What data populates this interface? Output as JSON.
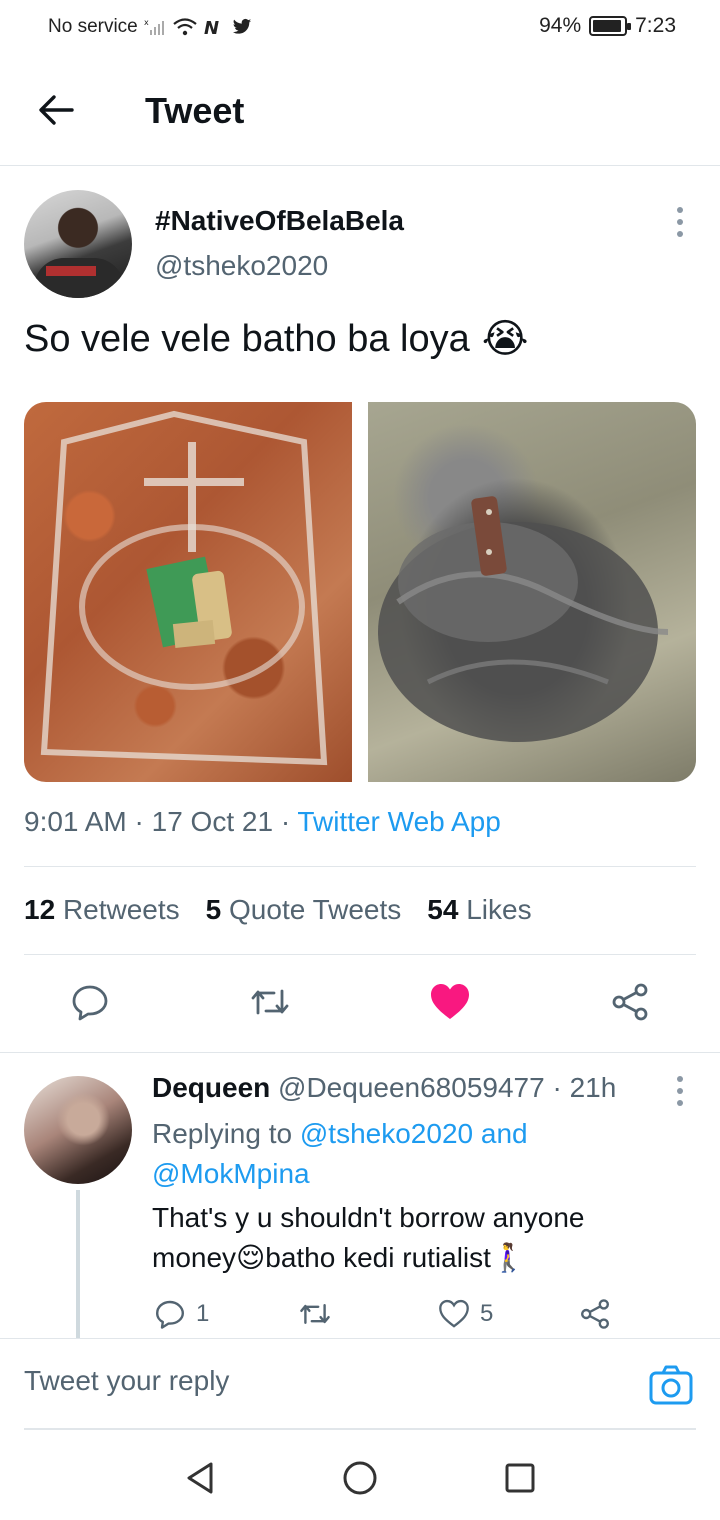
{
  "status_bar": {
    "carrier": "No service",
    "battery": "94%",
    "battery_fraction": 0.94,
    "time": "7:23"
  },
  "header": {
    "title": "Tweet"
  },
  "tweet": {
    "author_name": "#NativeOfBelaBela",
    "author_handle": "@tsheko2020",
    "text": "So vele vele batho ba loya",
    "emoji": "😭",
    "time": "9:01 AM",
    "date": "17 Oct 21",
    "separator": "·",
    "source": "Twitter Web App",
    "retweets_count": "12",
    "retweets_label": "Retweets",
    "quotes_count": "5",
    "quotes_label": "Quote Tweets",
    "likes_count": "54",
    "likes_label": "Likes",
    "liked": true
  },
  "reply": {
    "author_name": "Dequeen",
    "author_handle": "@Dequeen68059477",
    "age": "21h",
    "replying_prefix": "Replying to",
    "replying_to_1": "@tsheko2020",
    "replying_and": "and",
    "replying_to_2": "@MokMpina",
    "text_line1": "That's y u shouldn't borrow anyone",
    "text_line2_a": "money",
    "emoji_1": "😌",
    "text_line2_b": "batho kedi rutialist",
    "emoji_2": "🚶‍♀️",
    "reply_count": "1",
    "like_count": "5"
  },
  "composer": {
    "placeholder": "Tweet your reply"
  },
  "colors": {
    "accent": "#1d9bf0",
    "like": "#f91880",
    "muted": "#536471",
    "text": "#0f1419"
  }
}
